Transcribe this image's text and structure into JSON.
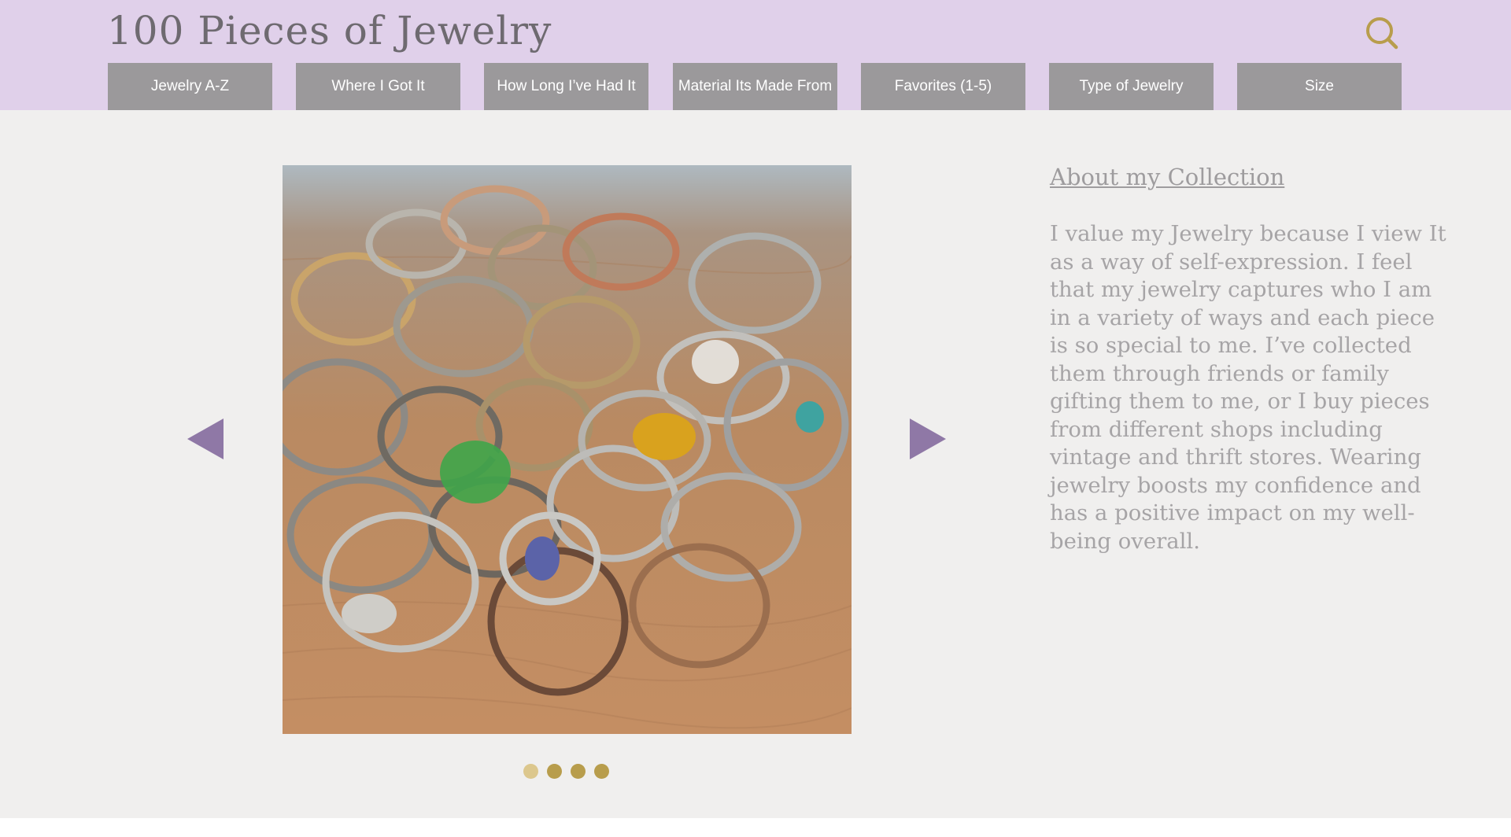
{
  "site": {
    "title": "100 Pieces of Jewelry"
  },
  "header": {
    "search_icon": "search-icon",
    "nav": [
      {
        "label": "Jewelry A-Z"
      },
      {
        "label": "Where I Got It"
      },
      {
        "label": "How Long I’ve Had It"
      },
      {
        "label": "Material Its Made From"
      },
      {
        "label": "Favorites (1-5)"
      },
      {
        "label": "Type of Jewelry"
      },
      {
        "label": "Size"
      }
    ]
  },
  "carousel": {
    "image": "photo of a pile of assorted silver, gold and copper rings on a wooden table",
    "prev_icon": "triangle-left-icon",
    "next_icon": "triangle-right-icon",
    "slide_count": 4,
    "active_slide": 1
  },
  "about": {
    "heading": "About my Collection",
    "body": "I value my Jewelry because I view It as a way of self-expression. I feel that my jewelry captures who I am in a variety of ways and each piece is so special to me. I’ve collected them through friends or family gifting them to me, or I buy pieces from different shops including vintage and thrift stores. Wearing jewelry boosts my confidence and has a positive impact on my well-being overall."
  },
  "colors": {
    "header_bg": "#e0d0ea",
    "nav_bg": "#9b999b",
    "accent_gold": "#b89d4c",
    "arrow_purple": "#8f78a6",
    "page_bg": "#f0efee"
  }
}
